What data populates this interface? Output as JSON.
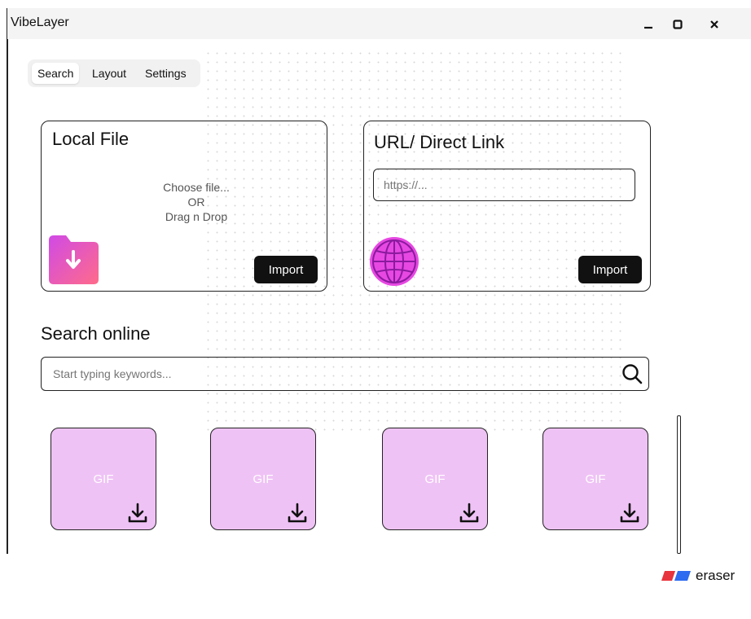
{
  "window": {
    "title": "VibeLayer",
    "minimize_label": "–",
    "maximize_label": "□",
    "close_label": "×"
  },
  "tabs": [
    {
      "label": "Search",
      "active": true
    },
    {
      "label": "Layout",
      "active": false
    },
    {
      "label": "Settings",
      "active": false
    }
  ],
  "local_file": {
    "title": "Local File",
    "dropzone": {
      "line1": "Choose file...",
      "line2": "OR",
      "line3": "Drag n Drop"
    },
    "import_label": "Import",
    "icon": "folder-download-icon"
  },
  "url_link": {
    "title": "URL/ Direct Link",
    "input_placeholder": "https://...",
    "import_label": "Import",
    "icon": "globe-icon"
  },
  "search_online": {
    "title": "Search online",
    "placeholder": "Start typing keywords...",
    "icon": "search-icon"
  },
  "results": [
    {
      "label": "GIF",
      "icon": "download-icon"
    },
    {
      "label": "GIF",
      "icon": "download-icon"
    },
    {
      "label": "GIF",
      "icon": "download-icon"
    },
    {
      "label": "GIF",
      "icon": "download-icon"
    }
  ],
  "brand": {
    "label": "eraser"
  },
  "colors": {
    "gif_tile": "#efc2f5",
    "accent_magenta": "#d93ad0",
    "folder_gradient_start": "#d04ae6",
    "folder_gradient_end": "#ff6b8a",
    "button_dark": "#111111"
  }
}
